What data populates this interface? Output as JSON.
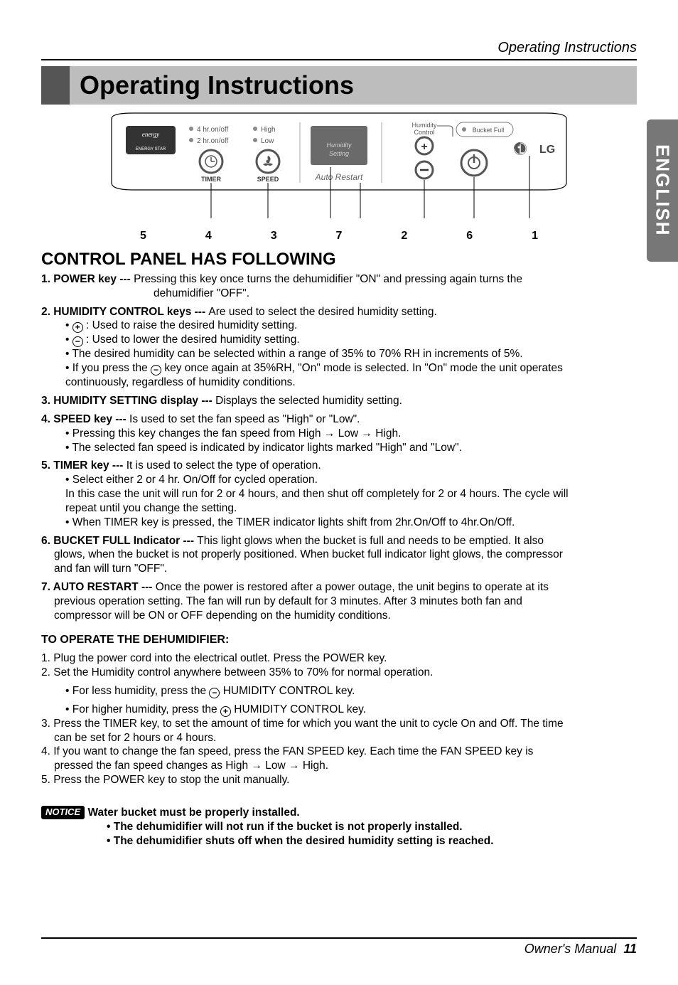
{
  "header": {
    "running": "Operating Instructions"
  },
  "title": "Operating Instructions",
  "lang_tab": "ENGLISH",
  "panel": {
    "timer": {
      "opt4": "4 hr.on/off",
      "opt2": "2 hr.on/off",
      "btn": "TIMER"
    },
    "speed": {
      "high": "High",
      "low": "Low",
      "btn": "SPEED"
    },
    "humidity_setting": {
      "label1": "Humidity",
      "label2": "Setting"
    },
    "auto_restart": "Auto Restart",
    "humidity_control": "Humidity\nControl",
    "bucket_full": "Bucket Full",
    "brand": "LG",
    "energy_star": "ENERGY STAR",
    "nums": [
      "5",
      "4",
      "3",
      "7",
      "2",
      "6",
      "1"
    ]
  },
  "section_heading": "CONTROL PANEL HAS FOLLOWING",
  "items": {
    "i1": {
      "lead": "1. POWER key --- ",
      "text": "Pressing this key once  turns the dehumidifier \"ON\" and pressing again turns the",
      "cont": "dehumidifier \"OFF\"."
    },
    "i2": {
      "lead": "2. HUMIDITY CONTROL keys --- ",
      "text": "Are used to select the desired humidity setting.",
      "b1a": "• ",
      "b1b": " : Used to raise the desired humidity setting.",
      "b2a": "• ",
      "b2b": " : Used to lower the desired humidity setting.",
      "b3": "• The desired humidity can be selected within a range of  35% to 70% RH  in  increments of 5%.",
      "b4a": "• If you press the ",
      "b4b": " key once again at 35%RH, \"On\" mode is selected. In \"On\" mode the unit operates",
      "b4c": "continuously, regardless of humidity conditions."
    },
    "i3": {
      "lead": "3. HUMIDITY SETTING display --- ",
      "text": "Displays the selected humidity setting."
    },
    "i4": {
      "lead": "4. SPEED key --- ",
      "text": "Is used to set the fan speed as \"High\" or \"Low\".",
      "b1": "• Pressing this key changes the fan speed from High → Low → High.",
      "b2": "• The selected fan speed is indicated by indicator lights marked \"High\" and \"Low\"."
    },
    "i5": {
      "lead": "5. TIMER  key --- ",
      "text": "It is used to select the type of operation.",
      "b1": "• Select either 2 or 4 hr. On/Off for cycled operation.",
      "b1c1": "In this case the unit will run for 2 or 4 hours, and then shut off completely for 2 or 4 hours. The cycle will",
      "b1c2": "repeat until you change the setting.",
      "b2": "• When TIMER key is pressed, the TIMER indicator lights shift from 2hr.On/Off to 4hr.On/Off."
    },
    "i6": {
      "lead": "6. BUCKET FULL Indicator --- ",
      "text": "This light glows when the bucket is full and needs to be emptied. It also",
      "c1": "glows, when the bucket is not properly positioned. When bucket full indicator light glows, the compressor",
      "c2": "and fan will turn \"OFF\"."
    },
    "i7": {
      "lead": "7. AUTO RESTART --- ",
      "text": "Once the power is restored after a power outage, the unit begins to operate at its",
      "c1": "previous operation setting. The fan will run by default for 3 minutes. After 3 minutes both fan and",
      "c2": "compressor will be ON or OFF depending on the humidity conditions."
    }
  },
  "operate_heading": "TO OPERATE THE DEHUMIDIFIER:",
  "operate": {
    "s1": "1. Plug the power cord into the electrical outlet. Press the POWER key.",
    "s2": "2. Set the Humidity control anywhere between 35% to 70% for normal operation.",
    "s2a_pre": "• For less humidity, press the ",
    "s2a_post": " HUMIDITY CONTROL key.",
    "s2b_pre": "• For higher humidity, press the ",
    "s2b_post": " HUMIDITY CONTROL key.",
    "s3": "3. Press the TIMER key, to set the amount of time for which you want the unit to cycle On and Off. The time",
    "s3c": "can be set for 2 hours or 4 hours.",
    "s4": "4. If you want to change the fan speed, press the FAN SPEED key. Each time the FAN SPEED key is",
    "s4c": "pressed the fan speed changes as High → Low → High.",
    "s5": "5. Press the POWER key to stop the unit manually."
  },
  "notice": {
    "badge": "NOTICE",
    "l1": "Water bucket must be properly installed.",
    "l2": "• The dehumidifier will not run if the bucket is not properly installed.",
    "l3": "• The dehumidifier shuts off when the desired humidity setting is reached."
  },
  "footer": {
    "label": "Owner's Manual",
    "page": "11"
  },
  "glyph": {
    "plus": "+",
    "minus": "−"
  }
}
